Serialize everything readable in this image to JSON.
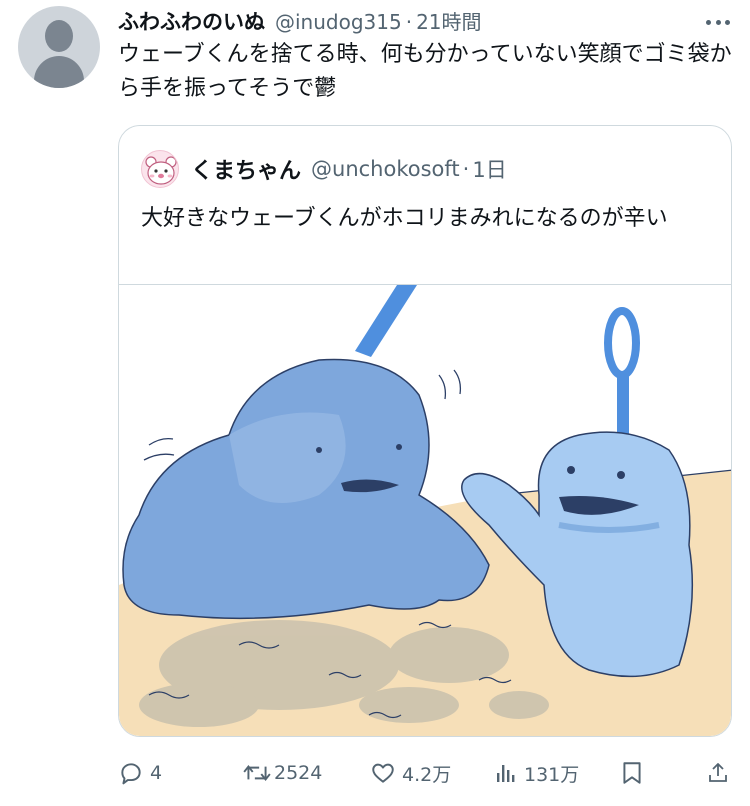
{
  "tweet": {
    "display_name": "ふわふわのいぬ",
    "handle": "@inudog315",
    "separator": "·",
    "time": "21時間",
    "text": "ウェーブくんを捨てる時、何も分かっていない笑顔でゴミ袋から手を振ってそうで鬱"
  },
  "quote": {
    "display_name": "くまちゃん",
    "handle": "@unchokosoft",
    "separator": "·",
    "time": "1日",
    "text": "大好きなウェーブくんがホコリまみれになるのが辛い"
  },
  "actions": {
    "reply_count": "4",
    "retweet_count": "2524",
    "like_count": "4.2万",
    "view_count": "131万"
  },
  "icons": [
    "more-icon",
    "reply-icon",
    "retweet-icon",
    "like-icon",
    "views-icon",
    "bookmark-icon",
    "share-icon"
  ],
  "colors": {
    "text": "#0f1419",
    "secondary": "#536471",
    "border": "#cfd9de",
    "mop_blue": "#8fb8e6",
    "floor": "#f6dfb8"
  }
}
